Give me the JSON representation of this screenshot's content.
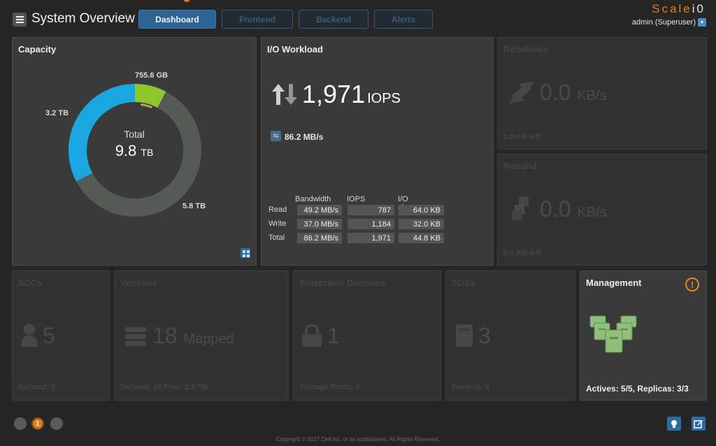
{
  "header": {
    "title": "System Overview",
    "tabs": [
      {
        "label": "Dashboard",
        "active": true
      },
      {
        "label": "Frontend",
        "active": false
      },
      {
        "label": "Backend",
        "active": false
      },
      {
        "label": "Alerts",
        "active": false
      }
    ],
    "brand_main": "Scale",
    "brand_suffix": "i0",
    "user": "admin (Superuser)"
  },
  "capacity": {
    "title": "Capacity",
    "total_label": "Total",
    "total_value": "9.8",
    "total_unit": "TB",
    "segments": [
      {
        "label": "3.2 TB",
        "value": 3.2,
        "color": "#1aa6e0"
      },
      {
        "label": "755.6 GB",
        "value": 0.7556,
        "color": "#8fc62e"
      },
      {
        "label": "5.8 TB",
        "value": 5.8,
        "color": "#555a56"
      }
    ],
    "thin_segment_color": "#c3a05a"
  },
  "io": {
    "title": "I/O Workload",
    "iops_value": "1,971",
    "iops_unit": "IOPS",
    "bandwidth": "86.2 MB/s",
    "columns": [
      "Bandwidth",
      "IOPS",
      "I/O size"
    ],
    "rows": [
      {
        "label": "Read",
        "cells": [
          "49.2 MB/s",
          "787",
          "64.0 KB"
        ]
      },
      {
        "label": "Write",
        "cells": [
          "37.0 MB/s",
          "1,184",
          "32.0 KB"
        ]
      },
      {
        "label": "Total",
        "cells": [
          "86.2 MB/s",
          "1,971",
          "44.8 KB"
        ]
      }
    ]
  },
  "rebalance": {
    "title": "Rebalance",
    "value": "0.0",
    "unit": "KB/s",
    "foot": "0.0 KB left"
  },
  "rebuild": {
    "title": "Rebuild",
    "value": "0.0",
    "unit": "KB/s",
    "foot": "0.0 KB left"
  },
  "sdcs": {
    "title": "SDCs",
    "value": "5",
    "foot": "Defined: 5"
  },
  "volumes": {
    "title": "Volumes",
    "value": "18",
    "unit": "Mapped",
    "foot": "Defined: 18  Free: 2.9 TB"
  },
  "protection": {
    "title": "Protection Domains",
    "value": "1",
    "foot": "Storage Pools: 1"
  },
  "sdss": {
    "title": "SDSs",
    "value": "3",
    "foot": "Devices: 6"
  },
  "management": {
    "title": "Management",
    "warning": "!",
    "foot": "Actives: 5/5, Replicas: 3/3"
  },
  "footer": {
    "dots": [
      "",
      "1",
      ""
    ],
    "copyright": "Copyright © 2017 Dell Inc. or its subsidiaries.  All Rights Reserved."
  }
}
